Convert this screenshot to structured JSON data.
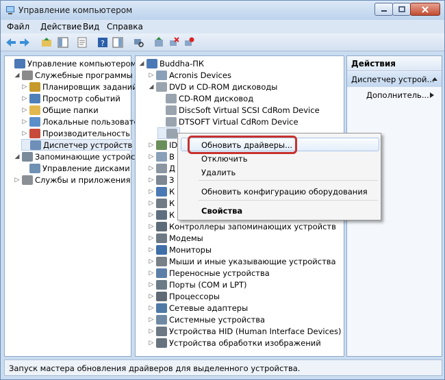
{
  "window": {
    "title": "Управление компьютером"
  },
  "menu": [
    "Файл",
    "Действие",
    "Вид",
    "Справка"
  ],
  "left_tree": [
    {
      "label": "Управление компьютером (л",
      "level": 0,
      "exp": "",
      "icon": "computer-icon"
    },
    {
      "label": "Служебные программы",
      "level": 1,
      "exp": "◢",
      "icon": "tools-icon"
    },
    {
      "label": "Планировщик заданий",
      "level": 2,
      "exp": "▷",
      "icon": "clock-icon"
    },
    {
      "label": "Просмотр событий",
      "level": 2,
      "exp": "▷",
      "icon": "event-viewer-icon"
    },
    {
      "label": "Общие папки",
      "level": 2,
      "exp": "▷",
      "icon": "shared-folder-icon"
    },
    {
      "label": "Локальные пользовате",
      "level": 2,
      "exp": "▷",
      "icon": "users-icon"
    },
    {
      "label": "Производительность",
      "level": 2,
      "exp": "▷",
      "icon": "performance-icon"
    },
    {
      "label": "Диспетчер устройств",
      "level": 2,
      "exp": "",
      "icon": "device-manager-icon",
      "selected": true
    },
    {
      "label": "Запоминающие устройства",
      "level": 1,
      "exp": "◢",
      "icon": "storage-icon"
    },
    {
      "label": "Управление дисками",
      "level": 2,
      "exp": "",
      "icon": "disk-management-icon"
    },
    {
      "label": "Службы и приложения",
      "level": 1,
      "exp": "▷",
      "icon": "services-icon"
    }
  ],
  "device_tree": [
    {
      "label": "Buddha-ПК",
      "level": 0,
      "exp": "◢",
      "icon": "computer-icon"
    },
    {
      "label": "Acronis Devices",
      "level": 1,
      "exp": "▷",
      "icon": "device-icon"
    },
    {
      "label": "DVD и CD-ROM дисководы",
      "level": 1,
      "exp": "◢",
      "icon": "dvd-drive-icon"
    },
    {
      "label": "CD-ROM дисковод",
      "level": 2,
      "exp": "",
      "icon": "dvd-drive-icon"
    },
    {
      "label": "DiscSoft Virtual SCSI CdRom Device",
      "level": 2,
      "exp": "",
      "icon": "dvd-drive-icon"
    },
    {
      "label": "DTSOFT Virtual CdRom Device",
      "level": 2,
      "exp": "",
      "icon": "dvd-drive-icon"
    },
    {
      "label": "",
      "level": 2,
      "exp": "",
      "icon": "dvd-drive-icon",
      "selected": true
    },
    {
      "label": "ID",
      "level": 1,
      "exp": "▷",
      "icon": "ide-icon"
    },
    {
      "label": "В",
      "level": 1,
      "exp": "▷",
      "icon": "device-icon"
    },
    {
      "label": "Д",
      "level": 1,
      "exp": "▷",
      "icon": "disk-icon"
    },
    {
      "label": "З",
      "level": 1,
      "exp": "▷",
      "icon": "sound-icon"
    },
    {
      "label": "К",
      "level": 1,
      "exp": "▷",
      "icon": "computer-icon"
    },
    {
      "label": "К",
      "level": 1,
      "exp": "▷",
      "icon": "keyboard-icon"
    },
    {
      "label": "К",
      "level": 1,
      "exp": "▷",
      "icon": "usb-icon"
    },
    {
      "label": "Контроллеры запоминающих устройств",
      "level": 1,
      "exp": "▷",
      "icon": "storage-controller-icon"
    },
    {
      "label": "Модемы",
      "level": 1,
      "exp": "▷",
      "icon": "modem-icon"
    },
    {
      "label": "Мониторы",
      "level": 1,
      "exp": "▷",
      "icon": "monitor-icon"
    },
    {
      "label": "Мыши и иные указывающие устройства",
      "level": 1,
      "exp": "▷",
      "icon": "mouse-icon"
    },
    {
      "label": "Переносные устройства",
      "level": 1,
      "exp": "▷",
      "icon": "portable-device-icon"
    },
    {
      "label": "Порты (COM и LPT)",
      "level": 1,
      "exp": "▷",
      "icon": "port-icon"
    },
    {
      "label": "Процессоры",
      "level": 1,
      "exp": "▷",
      "icon": "cpu-icon"
    },
    {
      "label": "Сетевые адаптеры",
      "level": 1,
      "exp": "▷",
      "icon": "network-adapter-icon"
    },
    {
      "label": "Системные устройства",
      "level": 1,
      "exp": "▷",
      "icon": "system-device-icon"
    },
    {
      "label": "Устройства HID (Human Interface Devices)",
      "level": 1,
      "exp": "▷",
      "icon": "hid-icon"
    },
    {
      "label": "Устройства обработки изображений",
      "level": 1,
      "exp": "▷",
      "icon": "camera-icon"
    }
  ],
  "context_menu": {
    "items": [
      "Обновить драйверы...",
      "Отключить",
      "Удалить",
      "Обновить конфигурацию оборудования",
      "Свойства"
    ]
  },
  "actions": {
    "header": "Действия",
    "section": "Диспетчер устрой...",
    "more": "Дополнитель..."
  },
  "status": "Запуск мастера обновления драйверов для выделенного устройства."
}
